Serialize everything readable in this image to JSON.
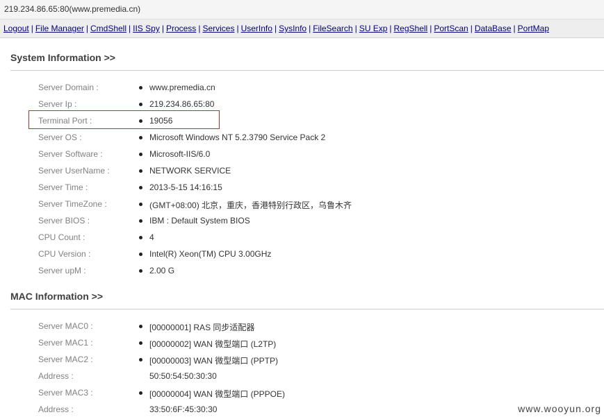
{
  "title_bar": {
    "url": "219.234.86.65:80(www.premedia.cn)"
  },
  "nav": {
    "links": [
      "Logout",
      "File Manager",
      "CmdShell",
      "IIS Spy",
      "Process",
      "Services",
      "UserInfo",
      "SysInfo",
      "FileSearch",
      "SU Exp",
      "RegShell",
      "PortScan",
      "DataBase",
      "PortMap"
    ],
    "separator": "|"
  },
  "system_info": {
    "title": "System Information >>",
    "rows": [
      {
        "label": "Server Domain :",
        "value": "www.premedia.cn"
      },
      {
        "label": "Server Ip :",
        "value": "219.234.86.65:80"
      },
      {
        "label": "Terminal Port :",
        "value": "19056"
      },
      {
        "label": "Server OS :",
        "value": "Microsoft Windows NT 5.2.3790 Service Pack 2"
      },
      {
        "label": "Server Software :",
        "value": "Microsoft-IIS/6.0"
      },
      {
        "label": "Server UserName :",
        "value": "NETWORK SERVICE"
      },
      {
        "label": "Server Time :",
        "value": "2013-5-15 14:16:15"
      },
      {
        "label": "Server TimeZone :",
        "value": "(GMT+08:00) 北京，重庆，香港特别行政区，乌鲁木齐"
      },
      {
        "label": "Server BIOS :",
        "value": "IBM : Default System BIOS"
      },
      {
        "label": "CPU Count :",
        "value": "4"
      },
      {
        "label": "CPU Version :",
        "value": "Intel(R) Xeon(TM) CPU 3.00GHz"
      },
      {
        "label": "Server upM :",
        "value": "2.00 G"
      }
    ]
  },
  "mac_info": {
    "title": "MAC Information >>",
    "rows": [
      {
        "label": "Server MAC0 :",
        "value": "[00000001] RAS 同步适配器",
        "bullet": true
      },
      {
        "label": "Server MAC1 :",
        "value": "[00000002] WAN 微型端口 (L2TP)",
        "bullet": true
      },
      {
        "label": "Server MAC2 :",
        "value": "[00000003] WAN 微型端口 (PPTP)",
        "bullet": true
      },
      {
        "label": "Address :",
        "value": "50:50:54:50:30:30",
        "bullet": false
      },
      {
        "label": "Server MAC3 :",
        "value": "[00000004] WAN 微型端口 (PPPOE)",
        "bullet": true
      },
      {
        "label": "Address :",
        "value": "33:50:6F:45:30:30",
        "bullet": false
      }
    ]
  },
  "watermark": "www.wooyun.org",
  "colors": {
    "highlight": "#e02020",
    "link": "#000080",
    "label": "#808080"
  }
}
